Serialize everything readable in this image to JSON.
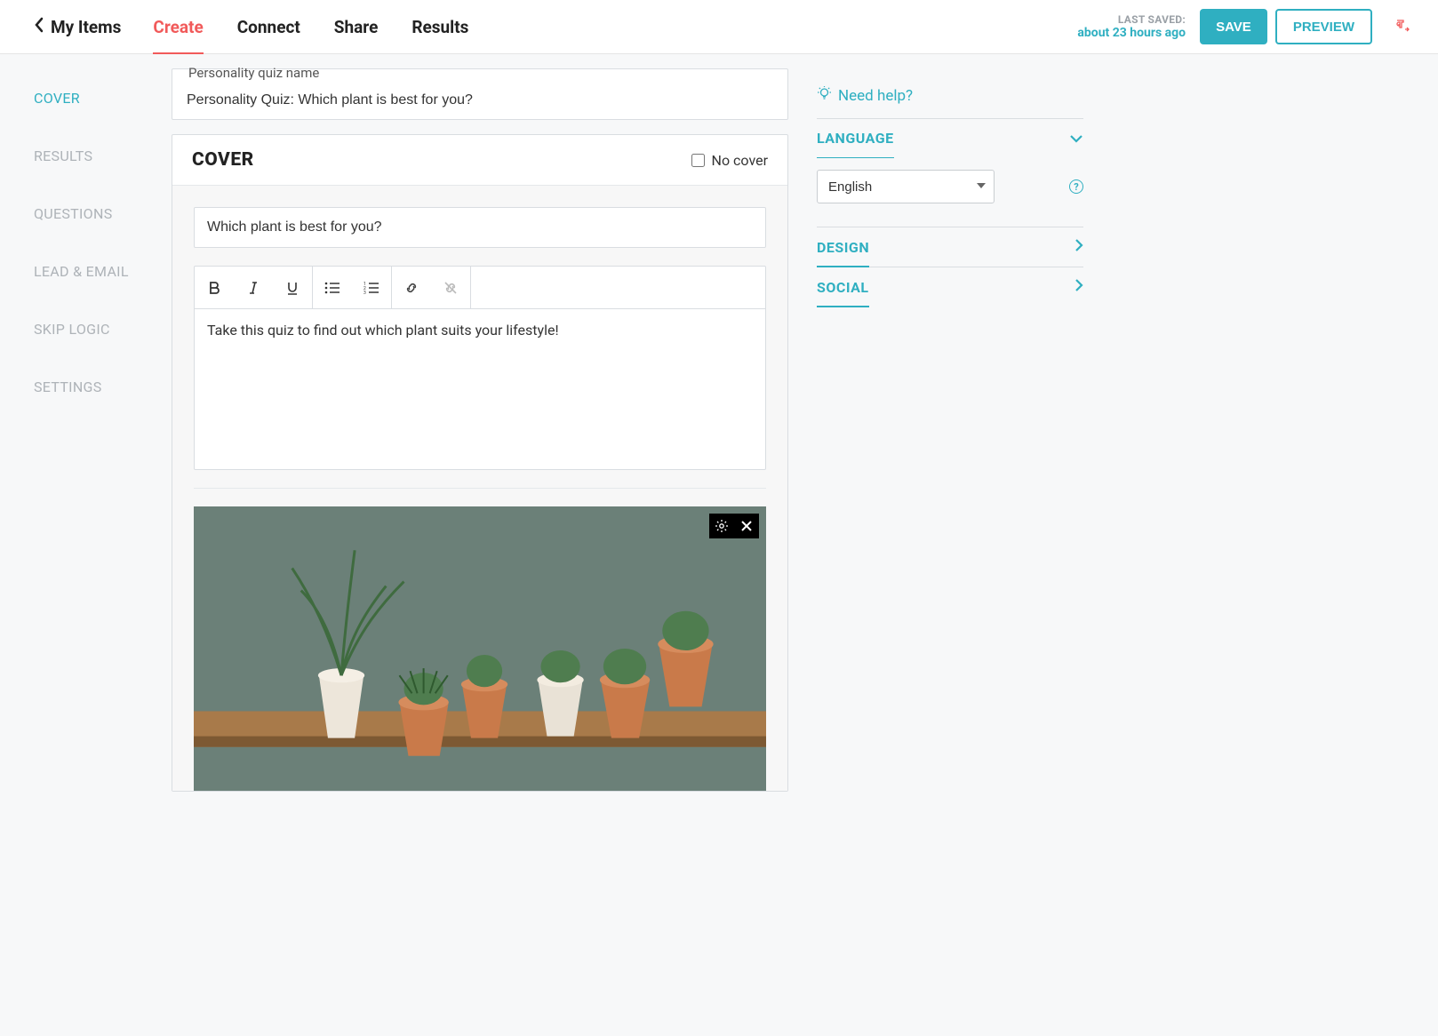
{
  "header": {
    "back_label": "My Items",
    "tabs": [
      "Create",
      "Connect",
      "Share",
      "Results"
    ],
    "active_tab": "Create",
    "last_saved_label": "LAST SAVED:",
    "last_saved_time": "about 23 hours ago",
    "save_label": "SAVE",
    "preview_label": "PREVIEW"
  },
  "sidebar": {
    "items": [
      "COVER",
      "RESULTS",
      "QUESTIONS",
      "LEAD & EMAIL",
      "SKIP LOGIC",
      "SETTINGS"
    ],
    "active": "COVER"
  },
  "main": {
    "name_legend": "Personality quiz name",
    "name_value": "Personality Quiz: Which plant is best for you?",
    "cover_title": "COVER",
    "no_cover_label": "No cover",
    "title_value": "Which plant is best for you?",
    "description_value": "Take this quiz to find out which plant suits your lifestyle!"
  },
  "right": {
    "help_label": "Need help?",
    "sections": {
      "language": {
        "title": "LANGUAGE",
        "value": "English"
      },
      "design": {
        "title": "DESIGN"
      },
      "social": {
        "title": "SOCIAL"
      }
    },
    "help_glyph": "?"
  }
}
